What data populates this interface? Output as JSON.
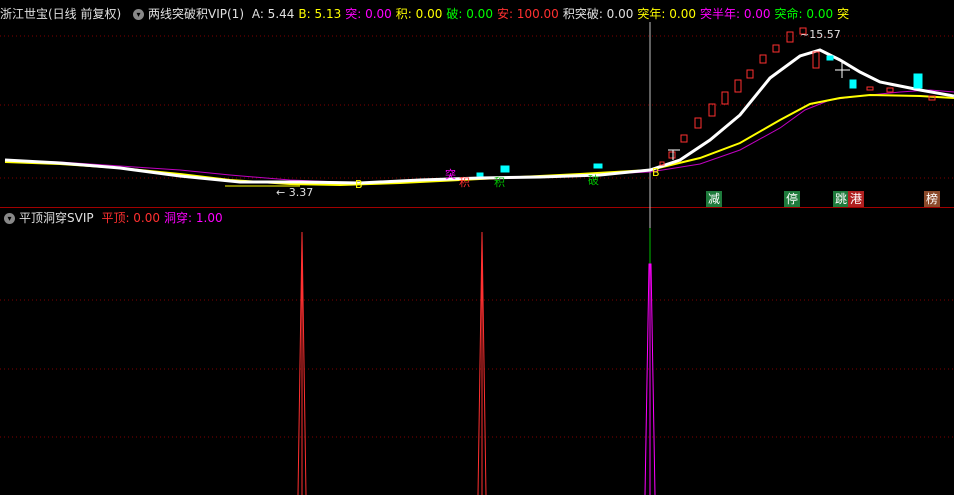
{
  "top_header": {
    "title": "浙江世宝(日线 前复权)",
    "indicator": "两线突破积VIP(1)",
    "values": [
      {
        "label": "A:",
        "value": "5.44",
        "color": "#e0e0e0"
      },
      {
        "label": "B:",
        "value": "5.13",
        "color": "#ffff00"
      },
      {
        "label": "突:",
        "value": "0.00",
        "color": "#ff00ff"
      },
      {
        "label": "积:",
        "value": "0.00",
        "color": "#ffff00"
      },
      {
        "label": "破:",
        "value": "0.00",
        "color": "#00ff00"
      },
      {
        "label": "安:",
        "value": "100.00",
        "color": "#ff3030"
      },
      {
        "label": "积突破:",
        "value": "0.00",
        "color": "#e0e0e0"
      },
      {
        "label": "突年:",
        "value": "0.00",
        "color": "#ffff00"
      },
      {
        "label": "突半年:",
        "value": "0.00",
        "color": "#ff00ff"
      },
      {
        "label": "突命:",
        "value": "0.00",
        "color": "#00ff00"
      },
      {
        "label": "突",
        "value": "",
        "color": "#ffff00"
      }
    ]
  },
  "bottom_header": {
    "indicator": "平顶洞穿SVIP",
    "values": [
      {
        "label": "平顶:",
        "value": "0.00",
        "color": "#ff3030"
      },
      {
        "label": "洞穿:",
        "value": "1.00",
        "color": "#ff00ff"
      }
    ]
  },
  "price_annotations": {
    "high": "15.57",
    "low": "3.37"
  },
  "signal_tags": [
    {
      "text": "减",
      "color": "#1e7a3c"
    },
    {
      "text": "停",
      "color": "#1e7a3c"
    },
    {
      "text": "跳",
      "color": "#1e7a3c"
    },
    {
      "text": "港",
      "color": "#b02020"
    },
    {
      "text": "榜",
      "color": "#8b4a2b"
    }
  ],
  "chart_labels": [
    {
      "text": "B",
      "color": "#ffff00"
    },
    {
      "text": "突",
      "color": "#ff00ff"
    },
    {
      "text": "积",
      "color": "#ff3030"
    },
    {
      "text": "积",
      "color": "#00c000"
    },
    {
      "text": "破",
      "color": "#00c000"
    },
    {
      "text": "B",
      "color": "#ffff00"
    }
  ],
  "colors": {
    "up": "#ff3030",
    "down": "#00ffff",
    "ma_a": "#ffffff",
    "ma_b": "#ffff00",
    "ma_c": "#c000c0",
    "grid": "#800000",
    "cursor": "#c0c0c0"
  }
}
